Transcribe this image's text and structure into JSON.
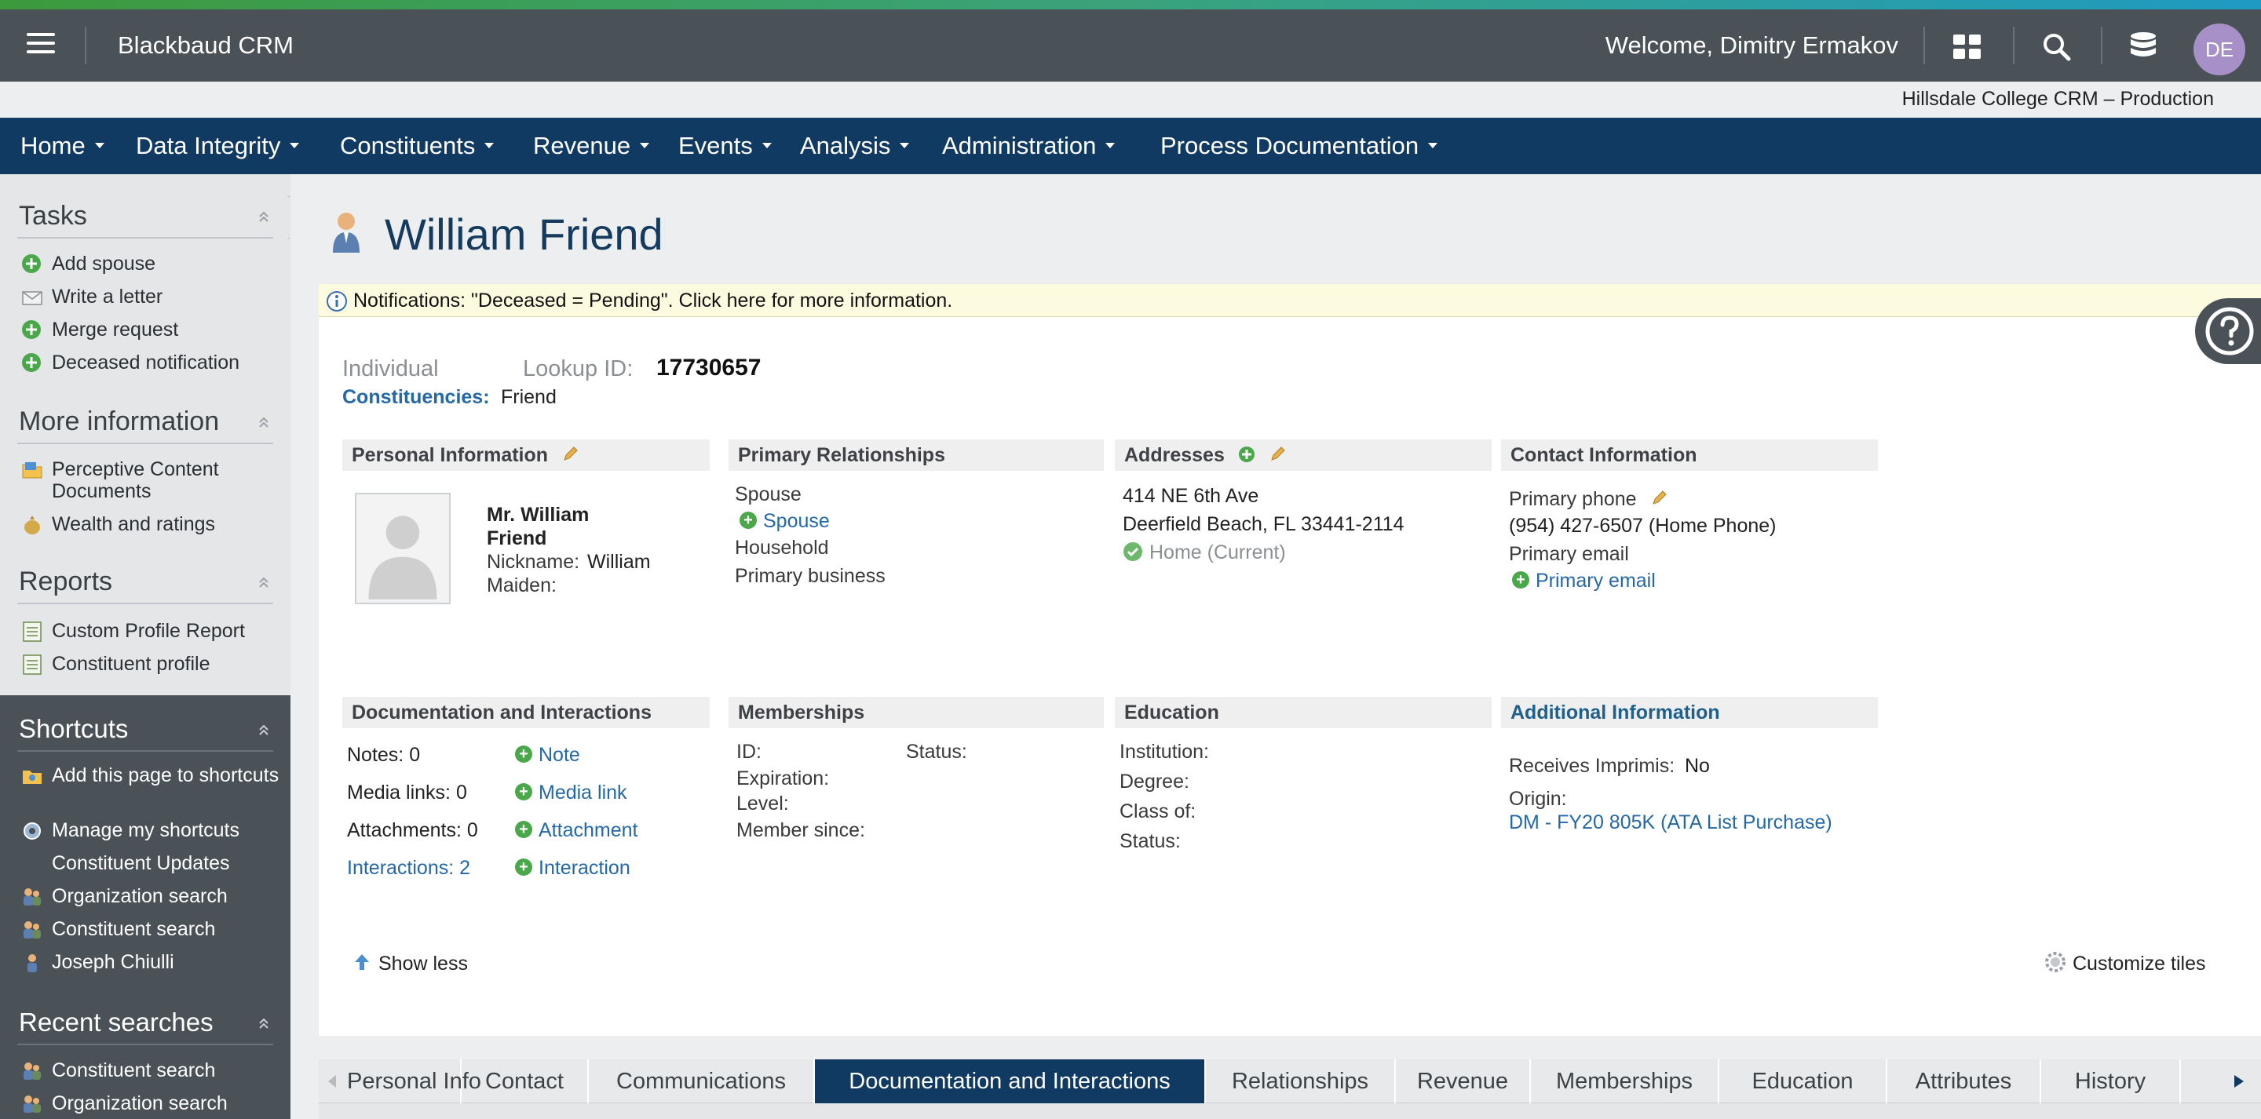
{
  "header": {
    "app_title": "Blackbaud CRM",
    "welcome": "Welcome, Dimitry Ermakov",
    "avatar_initials": "DE",
    "environment": "Hillsdale College CRM – Production",
    "icons": [
      "menu-icon",
      "apps-grid-icon",
      "search-icon",
      "database-icon"
    ]
  },
  "nav": {
    "items": [
      "Home",
      "Data Integrity",
      "Constituents",
      "Revenue",
      "Events",
      "Analysis",
      "Administration",
      "Process Documentation"
    ]
  },
  "sidebar": {
    "tasks": {
      "title": "Tasks",
      "items": [
        "Add spouse",
        "Write a letter",
        "Merge request",
        "Deceased notification"
      ]
    },
    "more_info": {
      "title": "More information",
      "items": [
        "Perceptive Content Documents",
        "Wealth and ratings"
      ]
    },
    "reports": {
      "title": "Reports",
      "items": [
        "Custom Profile Report",
        "Constituent profile"
      ]
    },
    "shortcuts": {
      "title": "Shortcuts",
      "items": [
        "Add this page to shortcuts",
        "Manage my shortcuts",
        "Constituent Updates",
        "Organization search",
        "Constituent search",
        "Joseph Chiulli"
      ]
    },
    "recent": {
      "title": "Recent searches",
      "items": [
        "Constituent search",
        "Organization search"
      ]
    }
  },
  "page": {
    "title": "William Friend",
    "notification": "Notifications: \"Deceased = Pending\". Click here for more information.",
    "type_label": "Individual",
    "lookup_label": "Lookup ID:",
    "lookup_value": "17730657",
    "constituencies_label": "Constituencies:",
    "constituencies_value": "Friend"
  },
  "tiles": {
    "personal": {
      "title": "Personal Information",
      "name_line1": "Mr. William",
      "name_line2": "Friend",
      "nickname_label": "Nickname:",
      "nickname_value": "William",
      "maiden_label": "Maiden:"
    },
    "relationships": {
      "title": "Primary Relationships",
      "spouse_label": "Spouse",
      "spouse_link": "Spouse",
      "household_label": "Household",
      "business_label": "Primary business"
    },
    "addresses": {
      "title": "Addresses",
      "line1": "414 NE 6th Ave",
      "line2": "Deerfield Beach, FL 33441-2114",
      "status": "Home (Current)"
    },
    "contact": {
      "title": "Contact Information",
      "phone_label": "Primary phone",
      "phone_value": "(954) 427-6507 (Home Phone)",
      "email_label": "Primary email",
      "email_link": "Primary email"
    },
    "documentation": {
      "title": "Documentation and Interactions",
      "notes": "Notes: 0",
      "media": "Media links: 0",
      "attachments": "Attachments: 0",
      "interactions": "Interactions: 2",
      "add_note": "Note",
      "add_media": "Media link",
      "add_attachment": "Attachment",
      "add_interaction": "Interaction"
    },
    "memberships": {
      "title": "Memberships",
      "id_label": "ID:",
      "status_label": "Status:",
      "expiration_label": "Expiration:",
      "level_label": "Level:",
      "since_label": "Member since:"
    },
    "education": {
      "title": "Education",
      "institution_label": "Institution:",
      "degree_label": "Degree:",
      "class_label": "Class of:",
      "status_label": "Status:"
    },
    "additional": {
      "title": "Additional Information",
      "imprimis_label": "Receives Imprimis:",
      "imprimis_value": "No",
      "origin_label": "Origin:",
      "origin_link": "DM - FY20 805K (ATA List Purchase)"
    }
  },
  "footer": {
    "show_less": "Show less",
    "customize": "Customize tiles"
  },
  "tabs": {
    "items": [
      "Personal Info",
      "Contact",
      "Communications",
      "Documentation and Interactions",
      "Relationships",
      "Revenue",
      "Memberships",
      "Education",
      "Attributes",
      "History"
    ],
    "active": "Documentation and Interactions"
  },
  "colors": {
    "navbar": "#103a62",
    "topbar": "#4a5157",
    "link": "#2468a8",
    "add_green": "#4aa84a"
  }
}
